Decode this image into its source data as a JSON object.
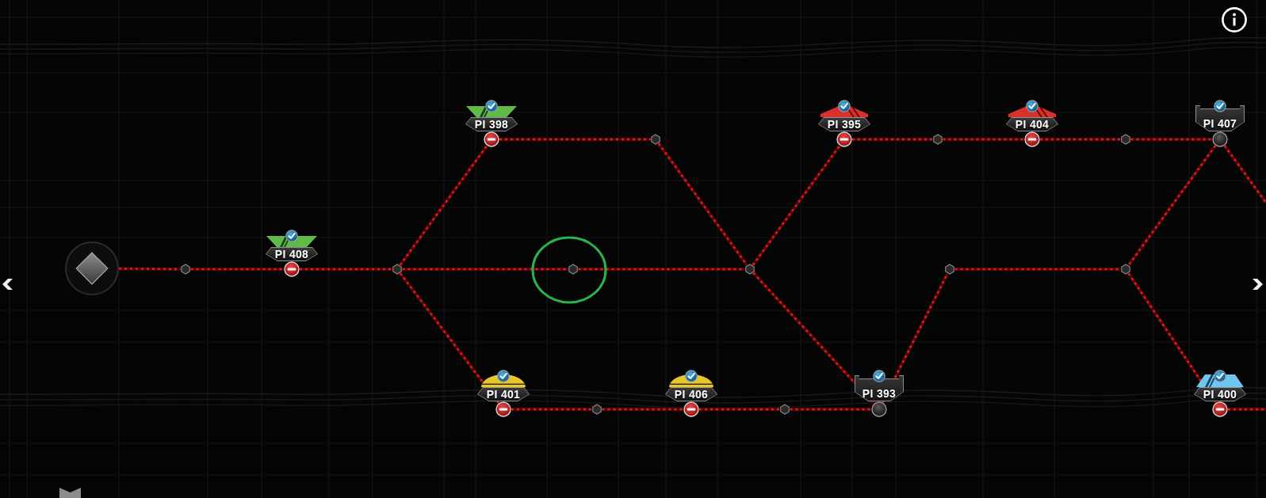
{
  "map": {
    "nodes": [
      {
        "label": "PI 398",
        "kind": "chevron",
        "color": "#5fba47",
        "checked": true,
        "blocked": true
      },
      {
        "label": "PI 395",
        "kind": "striped",
        "color": "#d9302c",
        "checked": true,
        "blocked": true
      },
      {
        "label": "PI 404",
        "kind": "striped",
        "color": "#d9302c",
        "checked": true,
        "blocked": true
      },
      {
        "label": "PI 407",
        "kind": "plain",
        "checked": true,
        "blocked": false
      },
      {
        "label": "PI 408",
        "kind": "chevron",
        "color": "#5fba47",
        "checked": true,
        "blocked": true
      },
      {
        "label": "PI 401",
        "kind": "dome",
        "color": "#e8c62e",
        "checked": true,
        "blocked": true
      },
      {
        "label": "PI 406",
        "kind": "dome",
        "color": "#e8c62e",
        "checked": true,
        "blocked": true
      },
      {
        "label": "PI 393",
        "kind": "plain",
        "checked": true,
        "blocked": false
      },
      {
        "label": "PI 400",
        "kind": "hex",
        "color": "#6ec6f0",
        "checked": true,
        "blocked": true
      }
    ],
    "waypoints": [
      {
        "selected": false
      },
      {
        "selected": false
      },
      {
        "selected": false
      },
      {
        "selected": false
      },
      {
        "selected": false
      },
      {
        "selected": true
      },
      {
        "selected": false
      },
      {
        "selected": false
      },
      {
        "selected": false
      },
      {
        "selected": false
      },
      {
        "selected": false
      }
    ]
  }
}
